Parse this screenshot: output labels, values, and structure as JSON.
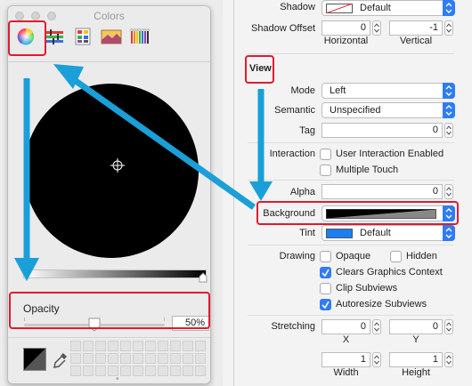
{
  "colors_panel": {
    "title": "Colors",
    "tools": [
      "color-wheel-icon",
      "sliders-icon",
      "palettes-icon",
      "image-icon",
      "pencils-icon"
    ],
    "opacity_label": "Opacity",
    "opacity_value": "50%",
    "opacity_level": 0.5
  },
  "inspector": {
    "shadow": {
      "label": "Shadow",
      "value": "Default"
    },
    "shadow_offset": {
      "label": "Shadow Offset",
      "h_value": "0",
      "v_value": "-1",
      "h_label": "Horizontal",
      "v_label": "Vertical"
    },
    "section_title": "View",
    "mode": {
      "label": "Mode",
      "value": "Left"
    },
    "semantic": {
      "label": "Semantic",
      "value": "Unspecified"
    },
    "tag": {
      "label": "Tag",
      "value": "0"
    },
    "interaction": {
      "label": "Interaction",
      "user_interaction": "User Interaction Enabled",
      "multiple_touch": "Multiple Touch"
    },
    "alpha": {
      "label": "Alpha",
      "value": "0"
    },
    "background": {
      "label": "Background"
    },
    "tint": {
      "label": "Tint",
      "value": "Default"
    },
    "drawing": {
      "label": "Drawing",
      "opaque": "Opaque",
      "hidden": "Hidden",
      "clears": "Clears Graphics Context",
      "clip": "Clip Subviews",
      "autoresize": "Autoresize Subviews"
    },
    "stretching": {
      "label": "Stretching",
      "x": "0",
      "y": "0",
      "width": "1",
      "height": "1",
      "x_label": "X",
      "y_label": "Y",
      "w_label": "Width",
      "h_label": "Height"
    }
  },
  "colors": {
    "accent": "#2e7cf6",
    "highlight": "#e01b2f",
    "arrow": "#1a9fd8"
  }
}
